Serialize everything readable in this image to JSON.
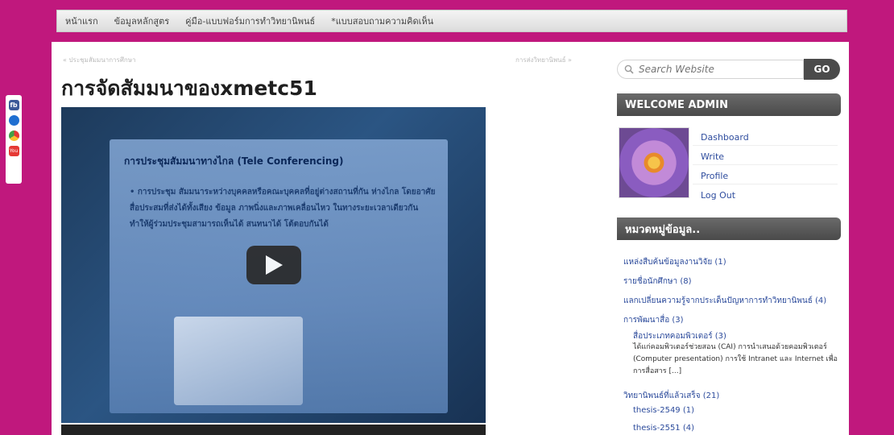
{
  "nav": {
    "items": [
      {
        "label": "หน้าแรก"
      },
      {
        "label": "ข้อมูลหลักสูตร"
      },
      {
        "label": "คู่มือ-แบบฟอร์มการทำวิทยานิพนธ์"
      },
      {
        "label": "*แบบสอบถามความคิดเห็น"
      }
    ]
  },
  "breadcrumb": {
    "left": "« ประชุมสัมมนาการศึกษา",
    "right": "การส่งวิทยานิพนธ์ »"
  },
  "post": {
    "title": "การจัดสัมมนาของxmetc51"
  },
  "video": {
    "slide_title": "การประชุมสัมมนาทางไกล (Tele Conferencing)",
    "slide_text": "• การประชุม สัมมนาระหว่างบุคคลหรือคณะบุคคลที่อยู่ต่างสถานที่กัน ห่างไกล โดยอาศัยสื่อประสมที่ส่งได้ทั้งเสียง ข้อมูล ภาพนิ่งและภาพเคลื่อนไหว ในทางระยะเวลาเดียวกัน ทำให้ผู้ร่วมประชุมสามารถเห็นได้ สนทนาได้ โต้ตอบกันได้"
  },
  "search": {
    "placeholder": "Search Website",
    "button": "GO"
  },
  "sidebar": {
    "welcome_title": "WELCOME ADMIN",
    "admin_links": [
      {
        "label": "Dashboard"
      },
      {
        "label": "Write"
      },
      {
        "label": "Profile"
      },
      {
        "label": "Log Out"
      }
    ],
    "categories_title": "หมวดหมู่ข้อมูล..",
    "categories": [
      {
        "label": "แหล่งสืบค้นข้อมูลงานวิจัย (1)"
      },
      {
        "label": "รายชื่อนักศึกษา (8)"
      },
      {
        "label": "แลกเปลี่ยนความรู้จากประเด็นปัญหาการทำวิทยานิพนธ์ (4)"
      },
      {
        "label": "การพัฒนาสื่อ (3)"
      },
      {
        "label": "สื่อประเภทคอมพิวเตอร์ (3)"
      },
      {
        "label": "วิทยานิพนธ์ที่แล้วเสร็จ (21)"
      },
      {
        "label": "thesis-2549 (1)"
      },
      {
        "label": "thesis-2551 (4)"
      }
    ],
    "category_desc": "ได้แก่คอมพิวเตอร์ช่วยสอน (CAI) การนำเสนอด้วยคอมพิวเตอร์ (Computer presentation) การใช้ Intranet และ Internet เพื่อการสื่อสาร [...]"
  },
  "social": [
    {
      "icon": "facebook-icon"
    },
    {
      "icon": "ie-icon"
    },
    {
      "icon": "chrome-icon"
    },
    {
      "icon": "youtube-icon"
    }
  ]
}
